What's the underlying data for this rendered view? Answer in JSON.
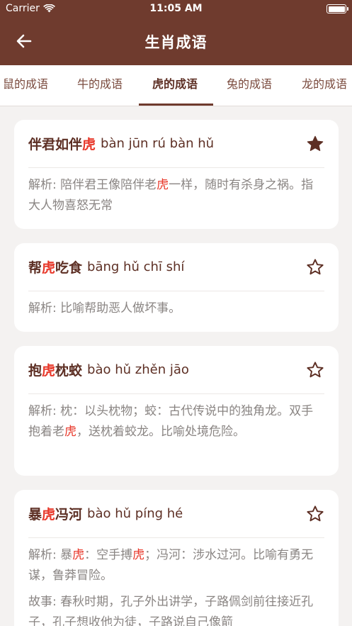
{
  "status_bar": {
    "carrier": "Carrier",
    "time": "11:05 AM"
  },
  "nav": {
    "title": "生肖成语"
  },
  "tabs": [
    "鼠的成语",
    "牛的成语",
    "虎的成语",
    "兔的成语",
    "龙的成语"
  ],
  "active_tab": "虎的成语",
  "colors": {
    "header": "#6f3b2e",
    "highlight": "#e8382a",
    "title_text": "#5d2f24"
  },
  "cards": [
    {
      "idiom": [
        "伴君如伴",
        "虎",
        ""
      ],
      "pinyin": "bàn jūn rú bàn hǔ",
      "starred": true,
      "explanation": [
        "解析: 陪伴君王像陪伴老",
        "虎",
        "一样，随时有杀身之祸。指大人物喜怒无常"
      ]
    },
    {
      "idiom": [
        "帮",
        "虎",
        "吃食"
      ],
      "pinyin": "bāng hǔ chī shí",
      "starred": false,
      "explanation": "解析: 比喻帮助恶人做坏事。"
    },
    {
      "idiom": [
        "抱",
        "虎",
        "枕蛟"
      ],
      "pinyin": "bào hǔ zhěn jāo",
      "starred": false,
      "explanation": [
        "解析: 枕：以头枕物；蛟：古代传说中的独角龙。双手抱着老",
        "虎",
        "，送枕着蛟龙。比喻处境危险。"
      ]
    },
    {
      "idiom": [
        "暴",
        "虎",
        "冯河"
      ],
      "pinyin": "bào hǔ píng hé",
      "starred": false,
      "explanation": [
        "解析: 暴",
        "虎",
        "：空手搏",
        "虎",
        "；冯河：涉水过河。比喻有勇无谋，鲁莽冒险。"
      ],
      "story": "故事: 春秋时期，孔子外出讲学，子路佩剑前往接近孔子，孔子想收他为徒，子路说自己像箭"
    }
  ]
}
